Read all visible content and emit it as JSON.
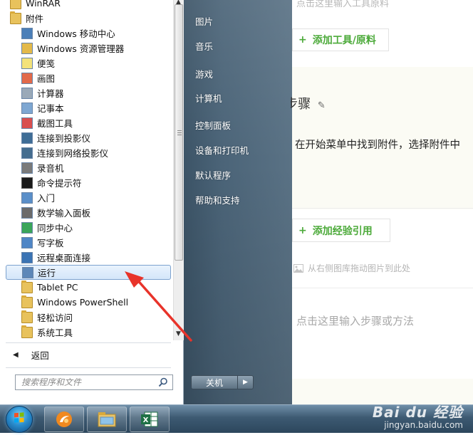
{
  "background_page": {
    "input_tools_hint": "点击这里输入工具原料",
    "add_tools_button": "添加工具/原料",
    "method_steps_title": "方法/步骤",
    "step_text": "在开始菜单中找到附件，选择附件中",
    "add_reference_button": "添加经验引用",
    "image_drop_hint": "从右侧图库拖动图片到此处",
    "step_input_hint": "点击这里输入步骤或方法",
    "accent_color": "#4caa3a"
  },
  "start_menu": {
    "programs": [
      {
        "label": "WinRAR",
        "icon": "folder-icon",
        "type": "folder"
      },
      {
        "label": "附件",
        "icon": "folder-open-icon",
        "type": "folder"
      },
      {
        "label": "Windows 移动中心",
        "icon": "mobility-center-icon",
        "type": "app"
      },
      {
        "label": "Windows 资源管理器",
        "icon": "explorer-folder-icon",
        "type": "app"
      },
      {
        "label": "便笺",
        "icon": "sticky-note-icon",
        "type": "app"
      },
      {
        "label": "画图",
        "icon": "paint-icon",
        "type": "app"
      },
      {
        "label": "计算器",
        "icon": "calculator-icon",
        "type": "app"
      },
      {
        "label": "记事本",
        "icon": "notepad-icon",
        "type": "app"
      },
      {
        "label": "截图工具",
        "icon": "snipping-tool-icon",
        "type": "app"
      },
      {
        "label": "连接到投影仪",
        "icon": "projector-icon",
        "type": "app"
      },
      {
        "label": "连接到网络投影仪",
        "icon": "network-projector-icon",
        "type": "app"
      },
      {
        "label": "录音机",
        "icon": "microphone-icon",
        "type": "app"
      },
      {
        "label": "命令提示符",
        "icon": "cmd-icon",
        "type": "app"
      },
      {
        "label": "入门",
        "icon": "getting-started-icon",
        "type": "app"
      },
      {
        "label": "数学输入面板",
        "icon": "math-input-icon",
        "type": "app"
      },
      {
        "label": "同步中心",
        "icon": "sync-center-icon",
        "type": "app"
      },
      {
        "label": "写字板",
        "icon": "wordpad-icon",
        "type": "app"
      },
      {
        "label": "远程桌面连接",
        "icon": "remote-desktop-icon",
        "type": "app"
      },
      {
        "label": "运行",
        "icon": "run-icon",
        "type": "app",
        "selected": true
      },
      {
        "label": "Tablet PC",
        "icon": "folder-icon",
        "type": "folder"
      },
      {
        "label": "Windows PowerShell",
        "icon": "folder-icon",
        "type": "folder"
      },
      {
        "label": "轻松访问",
        "icon": "folder-icon",
        "type": "folder"
      },
      {
        "label": "系统工具",
        "icon": "folder-icon",
        "type": "folder"
      }
    ],
    "back_label": "返回",
    "search_placeholder": "搜索程序和文件",
    "right_items": [
      "图片",
      "音乐",
      "游戏",
      "计算机",
      "控制面板",
      "设备和打印机",
      "默认程序",
      "帮助和支持"
    ],
    "shutdown_label": "关机",
    "selection_color": "#d4e6fa",
    "annotation_arrow_color": "#e8332a"
  },
  "taskbar": {
    "pinned": [
      "start-orb-icon",
      "browser-icon",
      "explorer-icon",
      "excel-icon"
    ],
    "watermark_brand": "Bai du 经验",
    "watermark_url": "jingyan.baidu.com"
  }
}
